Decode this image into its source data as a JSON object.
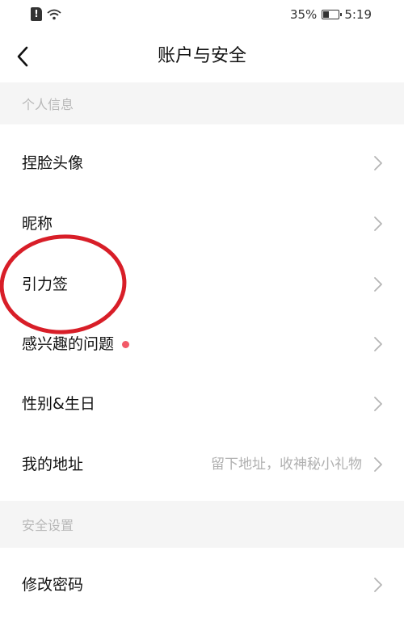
{
  "status_bar": {
    "battery_percent": "35%",
    "battery_level": 0.35,
    "time": "5:19",
    "icons": [
      "sim-alert-icon",
      "wifi-icon",
      "battery-icon"
    ]
  },
  "header": {
    "title": "账户与安全",
    "back_icon": "chevron-left-icon"
  },
  "sections": {
    "personal_info": "个人信息",
    "security_settings": "安全设置"
  },
  "rows": {
    "avatar": "捏脸头像",
    "nickname": "昵称",
    "signature": "引力签",
    "interests": "感兴趣的问题",
    "gender_birthday": "性别&生日",
    "address": "我的地址",
    "address_hint": "留下地址，收神秘小礼物",
    "change_password": "修改密码"
  },
  "colors": {
    "section_bg": "#f5f5f5",
    "red_dot": "#f25a68",
    "annotation_red": "#d81e28",
    "hint_text": "#b0b0b0"
  }
}
